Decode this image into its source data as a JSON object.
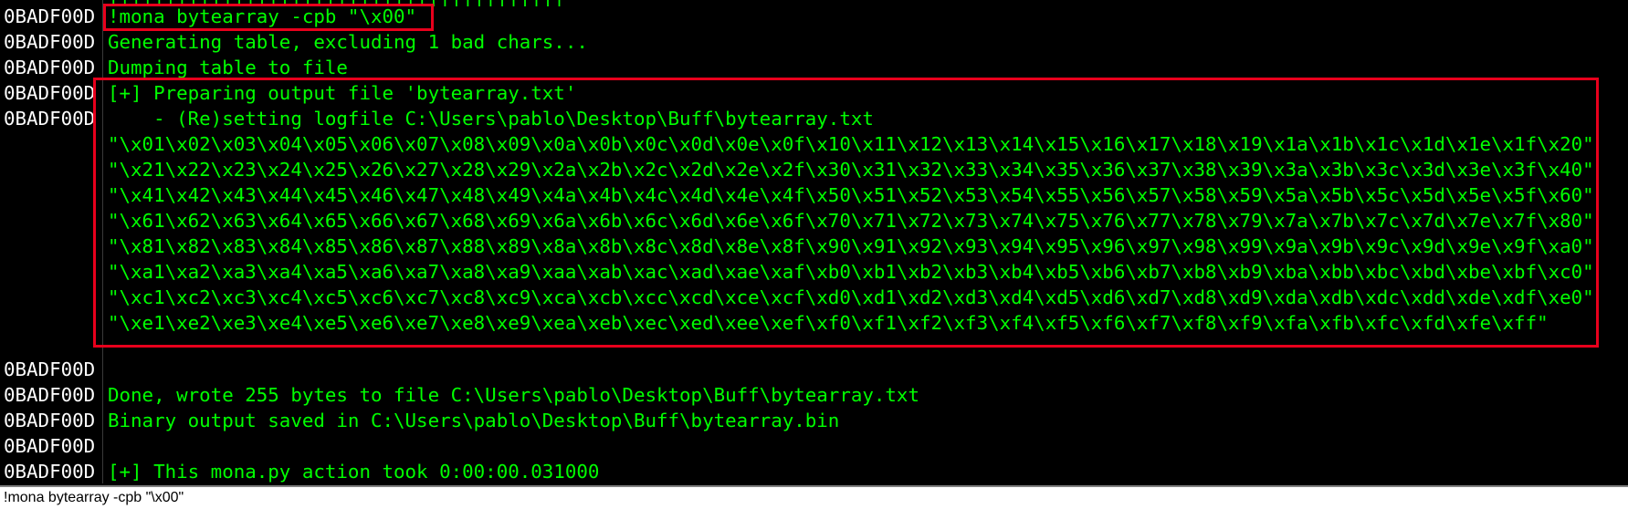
{
  "log": {
    "partial_top_text": "||||||||||||||||||||||||||||||||||||||||",
    "lines": [
      {
        "addr": "0BADF00D",
        "text": "!mona bytearray -cpb \"\\x00\""
      },
      {
        "addr": "0BADF00D",
        "text": "Generating table, excluding 1 bad chars..."
      },
      {
        "addr": "0BADF00D",
        "text": "Dumping table to file"
      },
      {
        "addr": "0BADF00D",
        "text": "[+] Preparing output file 'bytearray.txt'"
      },
      {
        "addr": "0BADF00D",
        "text": "    - (Re)setting logfile C:\\Users\\pablo\\Desktop\\Buff\\bytearray.txt"
      },
      {
        "addr": "",
        "text": "\"\\x01\\x02\\x03\\x04\\x05\\x06\\x07\\x08\\x09\\x0a\\x0b\\x0c\\x0d\\x0e\\x0f\\x10\\x11\\x12\\x13\\x14\\x15\\x16\\x17\\x18\\x19\\x1a\\x1b\\x1c\\x1d\\x1e\\x1f\\x20\""
      },
      {
        "addr": "",
        "text": "\"\\x21\\x22\\x23\\x24\\x25\\x26\\x27\\x28\\x29\\x2a\\x2b\\x2c\\x2d\\x2e\\x2f\\x30\\x31\\x32\\x33\\x34\\x35\\x36\\x37\\x38\\x39\\x3a\\x3b\\x3c\\x3d\\x3e\\x3f\\x40\""
      },
      {
        "addr": "",
        "text": "\"\\x41\\x42\\x43\\x44\\x45\\x46\\x47\\x48\\x49\\x4a\\x4b\\x4c\\x4d\\x4e\\x4f\\x50\\x51\\x52\\x53\\x54\\x55\\x56\\x57\\x58\\x59\\x5a\\x5b\\x5c\\x5d\\x5e\\x5f\\x60\""
      },
      {
        "addr": "",
        "text": "\"\\x61\\x62\\x63\\x64\\x65\\x66\\x67\\x68\\x69\\x6a\\x6b\\x6c\\x6d\\x6e\\x6f\\x70\\x71\\x72\\x73\\x74\\x75\\x76\\x77\\x78\\x79\\x7a\\x7b\\x7c\\x7d\\x7e\\x7f\\x80\""
      },
      {
        "addr": "",
        "text": "\"\\x81\\x82\\x83\\x84\\x85\\x86\\x87\\x88\\x89\\x8a\\x8b\\x8c\\x8d\\x8e\\x8f\\x90\\x91\\x92\\x93\\x94\\x95\\x96\\x97\\x98\\x99\\x9a\\x9b\\x9c\\x9d\\x9e\\x9f\\xa0\""
      },
      {
        "addr": "",
        "text": "\"\\xa1\\xa2\\xa3\\xa4\\xa5\\xa6\\xa7\\xa8\\xa9\\xaa\\xab\\xac\\xad\\xae\\xaf\\xb0\\xb1\\xb2\\xb3\\xb4\\xb5\\xb6\\xb7\\xb8\\xb9\\xba\\xbb\\xbc\\xbd\\xbe\\xbf\\xc0\""
      },
      {
        "addr": "",
        "text": "\"\\xc1\\xc2\\xc3\\xc4\\xc5\\xc6\\xc7\\xc8\\xc9\\xca\\xcb\\xcc\\xcd\\xce\\xcf\\xd0\\xd1\\xd2\\xd3\\xd4\\xd5\\xd6\\xd7\\xd8\\xd9\\xda\\xdb\\xdc\\xdd\\xde\\xdf\\xe0\""
      },
      {
        "addr": "",
        "text": "\"\\xe1\\xe2\\xe3\\xe4\\xe5\\xe6\\xe7\\xe8\\xe9\\xea\\xeb\\xec\\xed\\xee\\xef\\xf0\\xf1\\xf2\\xf3\\xf4\\xf5\\xf6\\xf7\\xf8\\xf9\\xfa\\xfb\\xfc\\xfd\\xfe\\xff\""
      },
      {
        "addr": "",
        "text": ""
      },
      {
        "addr": "0BADF00D",
        "text": ""
      },
      {
        "addr": "0BADF00D",
        "text": "Done, wrote 255 bytes to file C:\\Users\\pablo\\Desktop\\Buff\\bytearray.txt"
      },
      {
        "addr": "0BADF00D",
        "text": "Binary output saved in C:\\Users\\pablo\\Desktop\\Buff\\bytearray.bin"
      },
      {
        "addr": "0BADF00D",
        "text": ""
      },
      {
        "addr": "0BADF00D",
        "text": "[+] This mona.py action took 0:00:00.031000"
      }
    ]
  },
  "command_bar": {
    "value": "!mona bytearray -cpb \"\\x00\""
  },
  "colors": {
    "background": "#000000",
    "address_text": "#ffffff",
    "log_text": "#00ff00",
    "highlight_border": "#e8001c",
    "command_bar_bg": "#ffffff"
  }
}
